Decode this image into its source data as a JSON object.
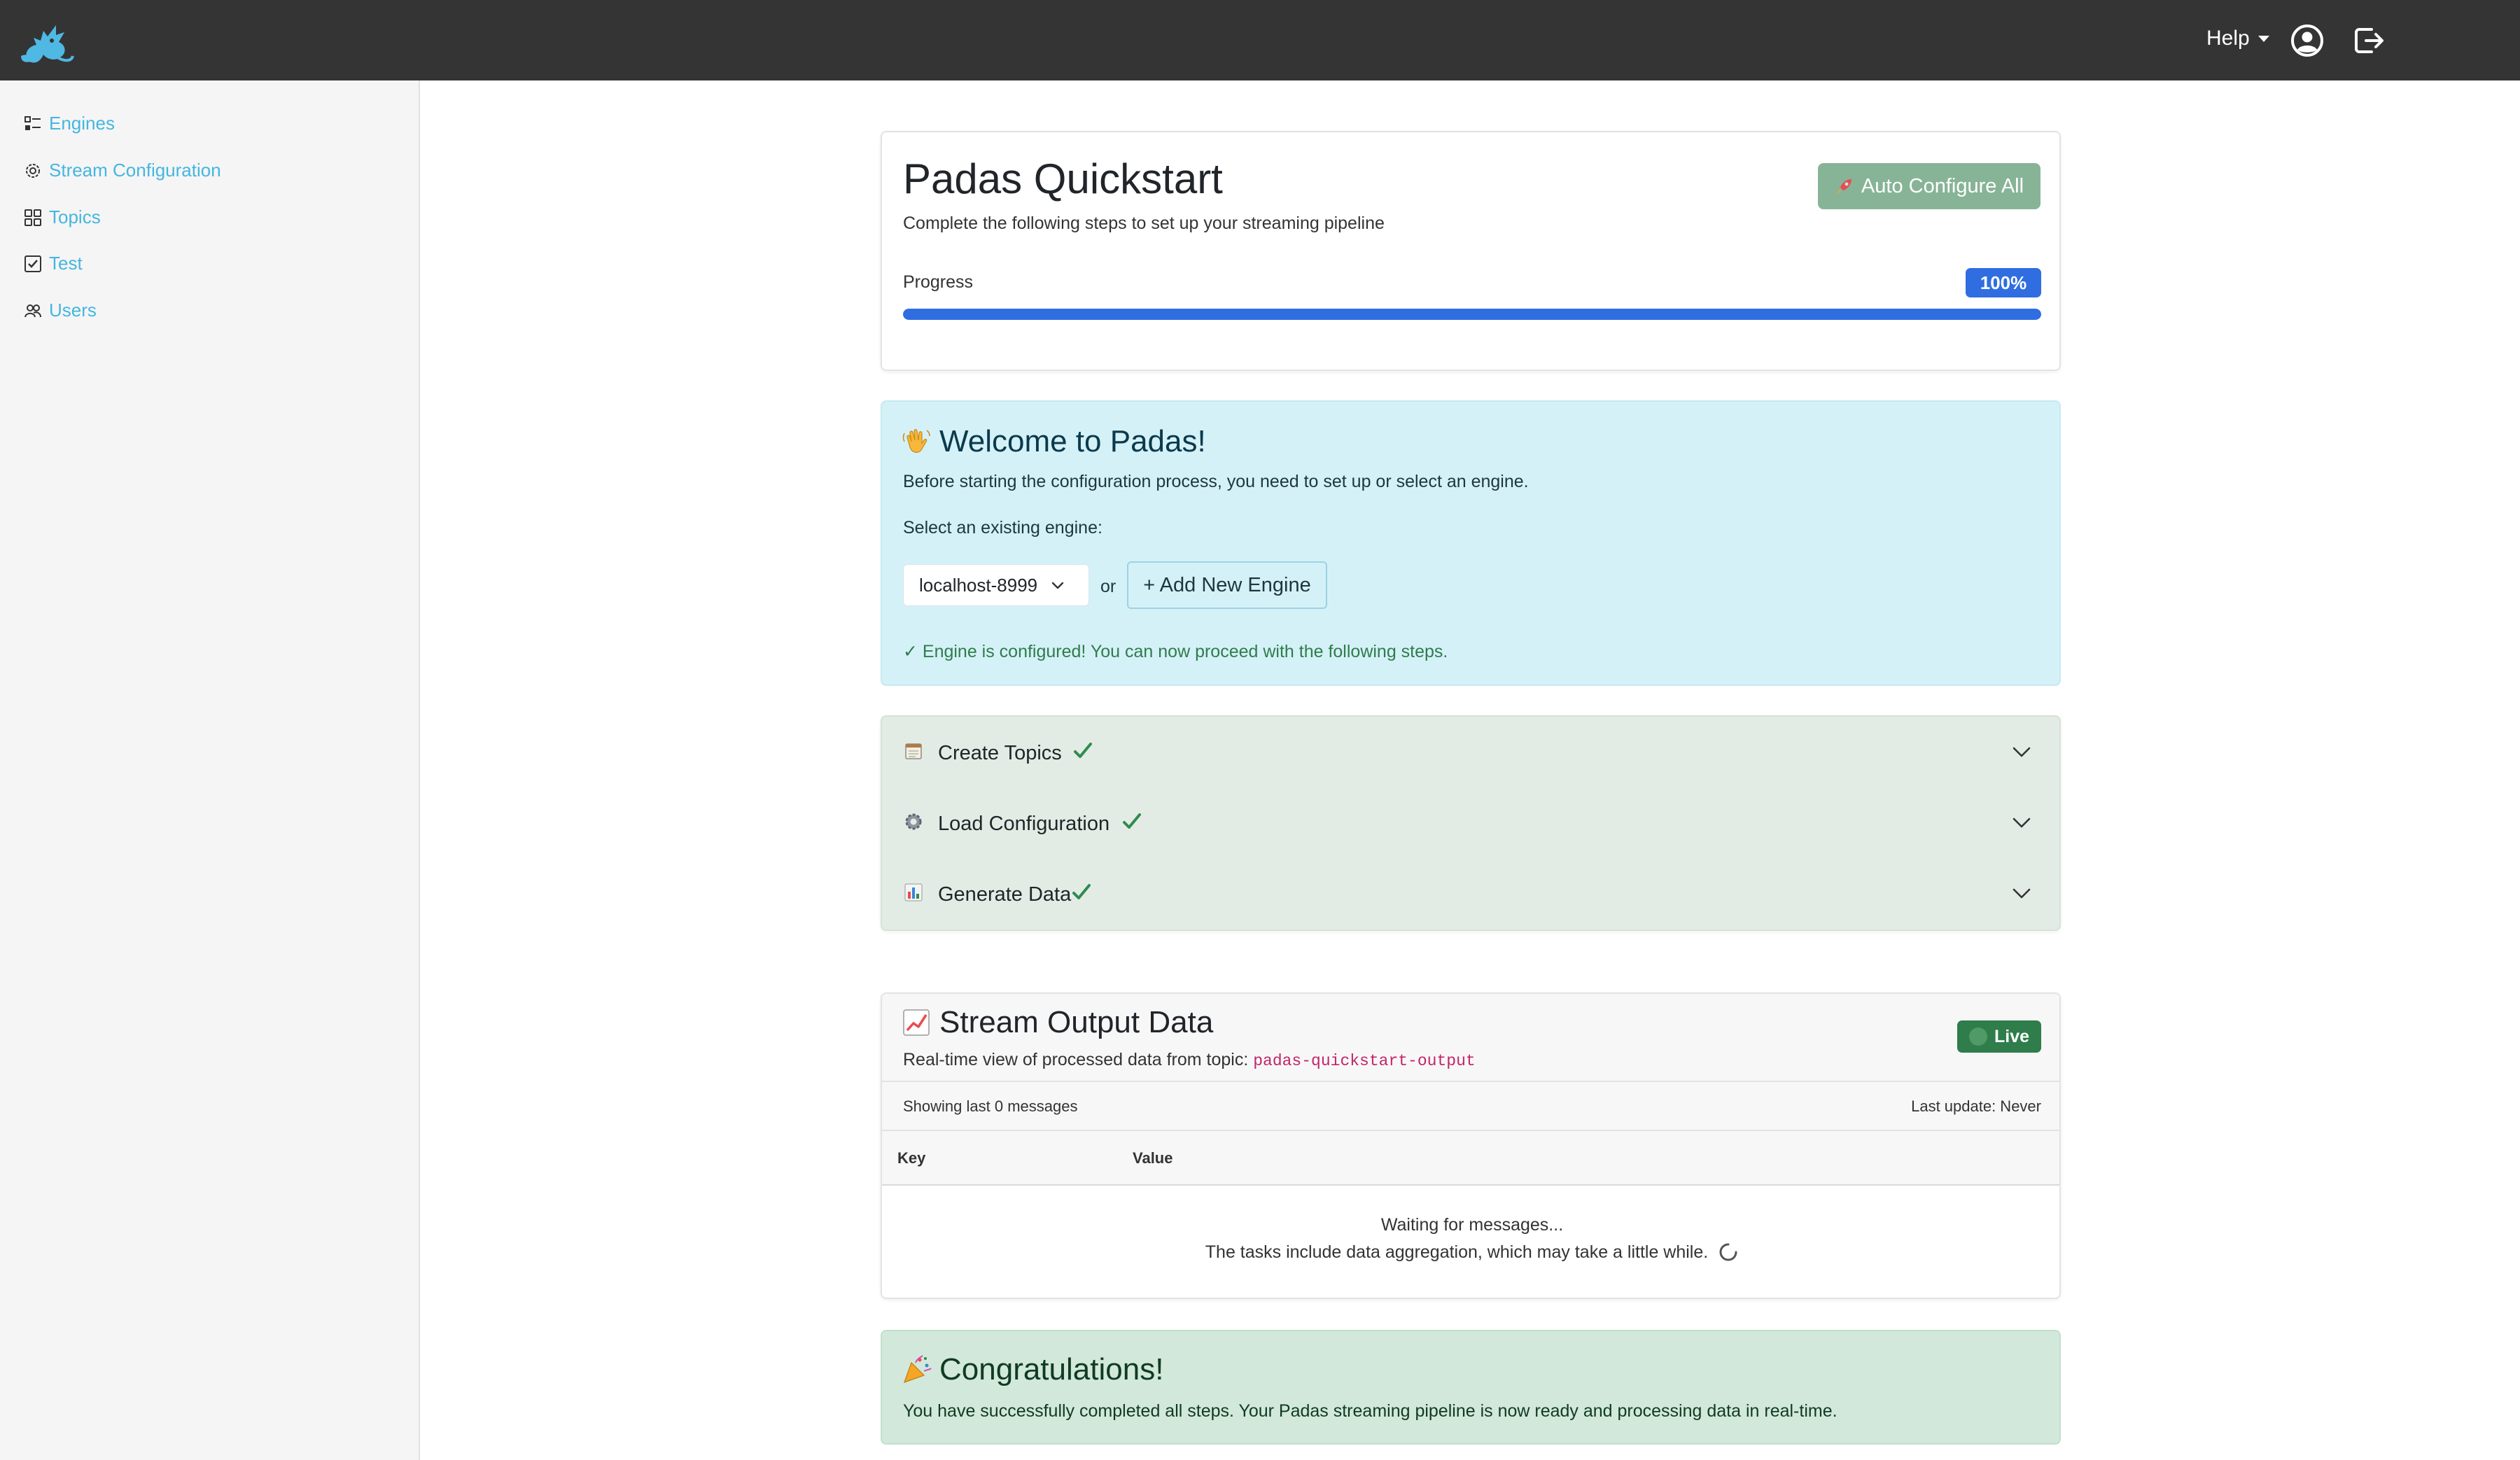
{
  "navbar": {
    "help_label": "Help"
  },
  "sidebar": {
    "items": [
      {
        "label": "Engines",
        "icon": "engines-icon"
      },
      {
        "label": "Stream Configuration",
        "icon": "gear-icon"
      },
      {
        "label": "Topics",
        "icon": "grid-icon"
      },
      {
        "label": "Test",
        "icon": "checkbox-icon"
      },
      {
        "label": "Users",
        "icon": "users-icon"
      }
    ],
    "link_color": "#45b6e0"
  },
  "quickstart": {
    "title": "Padas Quickstart",
    "subtitle": "Complete the following steps to set up your streaming pipeline",
    "auto_configure_label": "Auto Configure All",
    "progress_label": "Progress",
    "progress_badge": "100%",
    "progress_value": 100,
    "accent_color": "#2f6de1"
  },
  "welcome": {
    "title": "Welcome to Padas!",
    "description": "Before starting the configuration process, you need to set up or select an engine.",
    "select_label": "Select an existing engine:",
    "selected_engine": "localhost-8999",
    "or_text": "or",
    "add_engine_label": "+ Add New Engine",
    "configured_message": "✓ Engine is configured! You can now proceed with the following steps."
  },
  "steps": [
    {
      "label": "Create Topics",
      "icon": "notepad-icon",
      "done": true
    },
    {
      "label": "Load Configuration",
      "icon": "gear-icon",
      "done": true
    },
    {
      "label": "Generate Data",
      "icon": "bar-chart-icon",
      "done": true
    }
  ],
  "stream": {
    "title": "Stream Output Data",
    "subtitle_prefix": "Real-time view of processed data from topic:",
    "topic": "padas-quickstart-output",
    "live_label": "Live",
    "showing": "Showing last 0 messages",
    "last_update": "Last update: Never",
    "columns": [
      "Key",
      "Value"
    ],
    "waiting": "Waiting for messages...",
    "waiting_note": "The tasks include data aggregation, which may take a little while."
  },
  "congrats": {
    "title": "Congratulations!",
    "text": "You have successfully completed all steps. Your Padas streaming pipeline is now ready and processing data in real-time."
  }
}
